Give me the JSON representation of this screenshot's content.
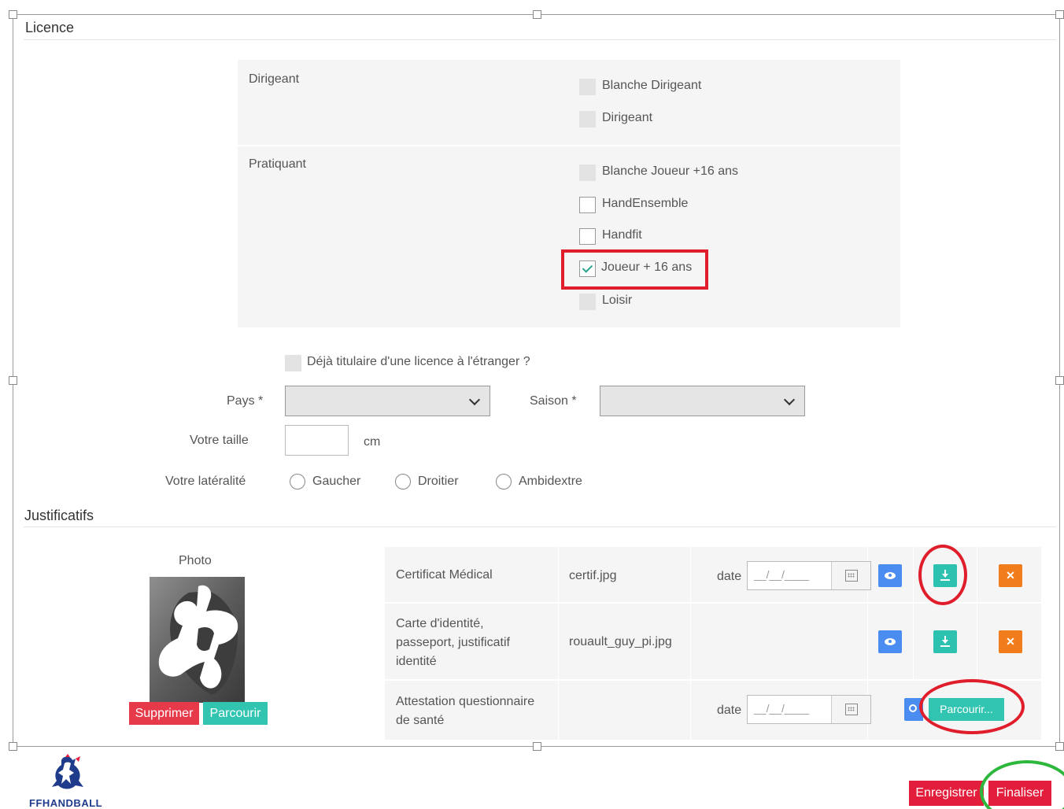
{
  "licence": {
    "title": "Licence",
    "groups": [
      {
        "label": "Dirigeant",
        "options": [
          {
            "label": "Blanche Dirigeant",
            "state": "disabled"
          },
          {
            "label": "Dirigeant",
            "state": "disabled"
          }
        ]
      },
      {
        "label": "Pratiquant",
        "options": [
          {
            "label": "Blanche Joueur +16 ans",
            "state": "disabled"
          },
          {
            "label": "HandEnsemble",
            "state": "unchecked"
          },
          {
            "label": "Handfit",
            "state": "unchecked"
          },
          {
            "label": "Joueur + 16 ans",
            "state": "checked"
          },
          {
            "label": "Loisir",
            "state": "disabled"
          }
        ]
      }
    ],
    "foreign_licence_label": "Déjà titulaire d'une licence à l'étranger ?",
    "pays_label": "Pays *",
    "saison_label": "Saison *",
    "taille_label": "Votre taille",
    "taille_unit": "cm",
    "lateralite_label": "Votre latéralité",
    "lateralite_options": [
      "Gaucher",
      "Droitier",
      "Ambidextre"
    ]
  },
  "justificatifs": {
    "title": "Justificatifs",
    "photo_label": "Photo",
    "photo_delete": "Supprimer",
    "photo_browse": "Parcourir",
    "rows": [
      {
        "name": "Certificat Médical",
        "file": "certif.jpg",
        "date_label": "date",
        "date_placeholder": "__/__/____"
      },
      {
        "name": "Carte d'identité, passeport, justificatif identité",
        "file": "rouault_guy_pi.jpg"
      },
      {
        "name": "Attestation questionnaire de santé",
        "file": "",
        "date_label": "date",
        "date_placeholder": "__/__/____",
        "browse_label": "Parcourir..."
      }
    ]
  },
  "footer": {
    "logo_text": "FFHANDBALL",
    "save_label": "Enregistrer",
    "finish_label": "Finaliser"
  },
  "colors": {
    "highlight_red": "#e01e2b",
    "highlight_green": "#2db83d",
    "teal": "#2dc2b0",
    "blue": "#4a8cf0",
    "orange": "#f07c1c"
  }
}
